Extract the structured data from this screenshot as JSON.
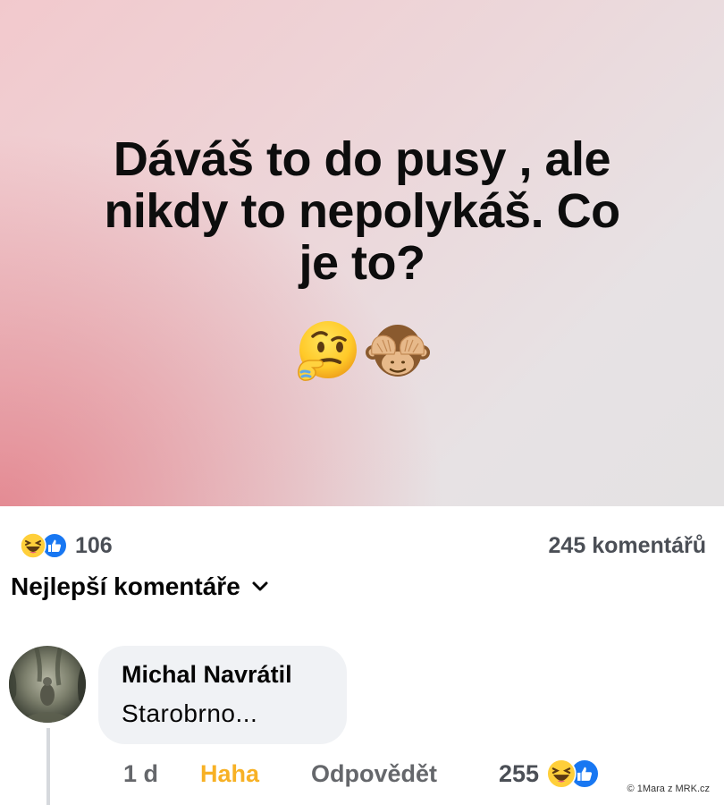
{
  "post": {
    "text_lines": [
      "Dáváš to do pusy , ale",
      "nikdy to nepolykáš. Co",
      "je to?"
    ],
    "emojis": [
      "thinking-face",
      "see-no-evil-monkey"
    ],
    "background_colors": [
      "#e27882",
      "#e4e2e3"
    ]
  },
  "reactions": {
    "icons": [
      "haha-reaction-icon",
      "like-reaction-icon"
    ],
    "count": "106",
    "comments_count": "245 komentářů"
  },
  "sort": {
    "label": "Nejlepší komentáře"
  },
  "comment": {
    "author": "Michal Navrátil",
    "text": "Starobrno...",
    "time": "1 d",
    "haha_label": "Haha",
    "reply_label": "Odpovědět",
    "reaction_count": "255"
  },
  "watermark": "© 1Mara z MRK.cz",
  "colors": {
    "like_blue": "#1877f2",
    "haha_yellow": "#f7b125",
    "secondary_text": "#65676b",
    "bubble_bg": "#f0f2f5"
  }
}
